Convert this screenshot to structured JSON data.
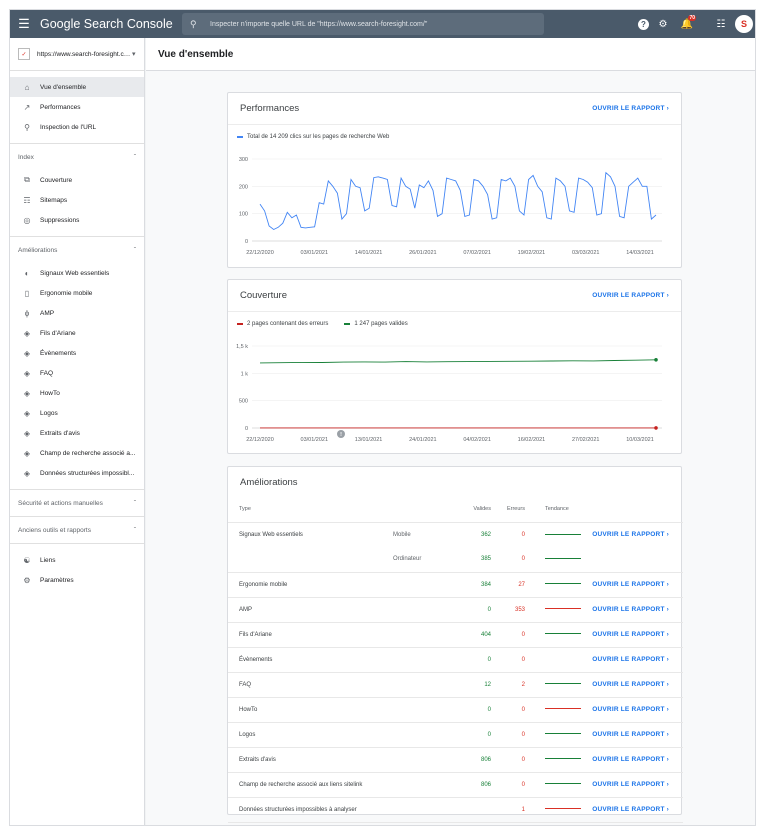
{
  "app": {
    "title": "Google Search Console",
    "search_placeholder": "Inspecter n'importe quelle URL de \"https://www.search-foresight.com/\"",
    "notif_count": "70",
    "avatar_text": "S"
  },
  "property": {
    "url": "https://www.search-foresight.com/"
  },
  "sidebar": {
    "top": [
      {
        "label": "Vue d'ensemble",
        "icon": "home-icon"
      },
      {
        "label": "Performances",
        "icon": "trending-up-icon"
      },
      {
        "label": "Inspection de l'URL",
        "icon": "search-icon"
      }
    ],
    "index_header": "Index",
    "index": [
      {
        "label": "Couverture",
        "icon": "copy-icon"
      },
      {
        "label": "Sitemaps",
        "icon": "sitemap-icon"
      },
      {
        "label": "Suppressions",
        "icon": "eye-off-icon"
      }
    ],
    "improve_header": "Améliorations",
    "improve": [
      {
        "label": "Signaux Web essentiels",
        "icon": "gauge-icon"
      },
      {
        "label": "Ergonomie mobile",
        "icon": "phone-icon"
      },
      {
        "label": "AMP",
        "icon": "bolt-icon"
      },
      {
        "label": "Fils d'Ariane",
        "icon": "layers-icon"
      },
      {
        "label": "Évènements",
        "icon": "layers-icon"
      },
      {
        "label": "FAQ",
        "icon": "layers-icon"
      },
      {
        "label": "HowTo",
        "icon": "layers-icon"
      },
      {
        "label": "Logos",
        "icon": "layers-icon"
      },
      {
        "label": "Extraits d'avis",
        "icon": "layers-icon"
      },
      {
        "label": "Champ de recherche associé a...",
        "icon": "layers-icon"
      },
      {
        "label": "Données structurées impossibl...",
        "icon": "layers-icon"
      }
    ],
    "security_header": "Sécurité et actions manuelles",
    "legacy_header": "Anciens outils et rapports",
    "bottom": [
      {
        "label": "Liens",
        "icon": "links-icon"
      },
      {
        "label": "Paramètres",
        "icon": "gear-icon"
      }
    ]
  },
  "page": {
    "title": "Vue d'ensemble"
  },
  "report_link": "OUVRIR LE RAPPORT",
  "performance": {
    "title": "Performances",
    "legend": "Total de 14 209 clics sur les pages de recherche Web",
    "color": "#4285f4"
  },
  "coverage": {
    "title": "Couverture",
    "legend_errors": "2 pages contenant des erreurs",
    "legend_valid": "1 247 pages valides",
    "error_color": "#c5221f",
    "valid_color": "#188038"
  },
  "enhancements": {
    "title": "Améliorations",
    "headers": {
      "type": "Type",
      "valid": "Valides",
      "errors": "Erreurs",
      "trend": "Tendance"
    },
    "rows": [
      {
        "type": "Signaux Web essentiels",
        "sub": "Mobile",
        "valid": "362",
        "errors": "0",
        "trend": "green",
        "link": true
      },
      {
        "type": "",
        "sub": "Ordinateur",
        "valid": "385",
        "errors": "0",
        "trend": "green",
        "link": false
      },
      {
        "type": "Ergonomie mobile",
        "sub": "",
        "valid": "384",
        "errors": "27",
        "trend": "green",
        "link": true
      },
      {
        "type": "AMP",
        "sub": "",
        "valid": "0",
        "errors": "353",
        "trend": "red",
        "link": true
      },
      {
        "type": "Fils d'Ariane",
        "sub": "",
        "valid": "404",
        "errors": "0",
        "trend": "green",
        "link": true
      },
      {
        "type": "Évènements",
        "sub": "",
        "valid": "0",
        "errors": "0",
        "trend": "none",
        "link": true
      },
      {
        "type": "FAQ",
        "sub": "",
        "valid": "12",
        "errors": "2",
        "trend": "green",
        "link": true
      },
      {
        "type": "HowTo",
        "sub": "",
        "valid": "0",
        "errors": "0",
        "trend": "red",
        "link": true
      },
      {
        "type": "Logos",
        "sub": "",
        "valid": "0",
        "errors": "0",
        "trend": "green",
        "link": true
      },
      {
        "type": "Extraits d'avis",
        "sub": "",
        "valid": "806",
        "errors": "0",
        "trend": "green",
        "link": true
      },
      {
        "type": "Champ de recherche associé aux liens sitelink",
        "sub": "",
        "valid": "806",
        "errors": "0",
        "trend": "green",
        "link": true
      },
      {
        "type": "Données structurées impossibles à analyser",
        "sub": "",
        "valid": "",
        "errors": "1",
        "trend": "red",
        "link": true
      }
    ]
  },
  "chart_data": [
    {
      "type": "line",
      "title": "",
      "ylim": [
        0,
        300
      ],
      "yticks": [
        "300",
        "200",
        "100",
        "0"
      ],
      "xticks": [
        "22/12/2020",
        "03/01/2021",
        "14/01/2021",
        "26/01/2021",
        "07/02/2021",
        "19/02/2021",
        "03/03/2021",
        "14/03/2021"
      ],
      "series": [
        {
          "name": "Total de 14 209 clics sur les pages de recherche Web",
          "values": [
            135,
            110,
            55,
            42,
            50,
            65,
            105,
            85,
            95,
            50,
            48,
            50,
            52,
            140,
            135,
            220,
            200,
            175,
            80,
            100,
            225,
            200,
            195,
            110,
            120,
            232,
            235,
            230,
            225,
            130,
            125,
            230,
            200,
            190,
            120,
            205,
            195,
            220,
            185,
            90,
            100,
            230,
            225,
            220,
            185,
            90,
            95,
            225,
            220,
            200,
            170,
            80,
            85,
            225,
            220,
            230,
            200,
            110,
            95,
            225,
            240,
            200,
            180,
            85,
            80,
            230,
            220,
            200,
            110,
            105,
            230,
            225,
            215,
            195,
            95,
            100,
            250,
            235,
            200,
            90,
            85,
            200,
            215,
            230,
            200,
            200,
            80,
            95
          ]
        }
      ]
    },
    {
      "type": "line",
      "title": "",
      "ylim": [
        0,
        1500
      ],
      "yticks": [
        "1,5 k",
        "1 k",
        "500",
        "0"
      ],
      "xticks": [
        "22/12/2020",
        "03/01/2021",
        "13/01/2021",
        "24/01/2021",
        "04/02/2021",
        "16/02/2021",
        "27/02/2021",
        "10/03/2021"
      ],
      "series": [
        {
          "name": "2 pages contenant des erreurs",
          "values": [
            2,
            2,
            2,
            2,
            2,
            2,
            2,
            2,
            2,
            2,
            2,
            2,
            2,
            2,
            2,
            2,
            2,
            2,
            2,
            2
          ]
        },
        {
          "name": "1 247 pages valides",
          "values": [
            1190,
            1195,
            1200,
            1198,
            1205,
            1210,
            1205,
            1215,
            1210,
            1212,
            1215,
            1218,
            1220,
            1222,
            1225,
            1230,
            1228,
            1235,
            1240,
            1247
          ]
        }
      ]
    }
  ]
}
